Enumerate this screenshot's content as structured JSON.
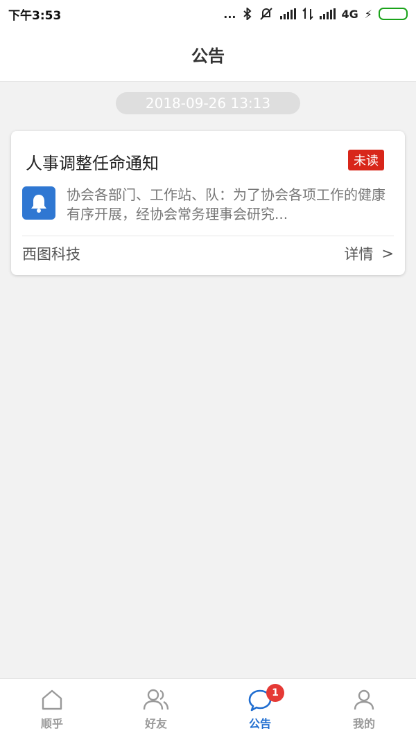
{
  "status_bar": {
    "time": "下午3:53",
    "dots": "...",
    "network": "4G",
    "charging": "⚡"
  },
  "header": {
    "title": "公告"
  },
  "feed": {
    "date": "2018-09-26 13:13",
    "card": {
      "title": "人事调整任命通知",
      "badge": "未读",
      "summary": "协会各部门、工作站、队：为了协会各项工作的健康有序开展，经协会常务理事会研究...",
      "source": "西图科技",
      "detail_label": "详情",
      "detail_arrow": ">"
    }
  },
  "bottom_nav": {
    "items": [
      {
        "label": "顺乎",
        "icon": "home-icon"
      },
      {
        "label": "好友",
        "icon": "friends-icon"
      },
      {
        "label": "公告",
        "icon": "chat-bubble-icon",
        "badge": "1",
        "active": true
      },
      {
        "label": "我的",
        "icon": "person-icon"
      }
    ]
  },
  "colors": {
    "accent": "#1f6dd0",
    "badge_red": "#d8261a",
    "bell_bg": "#2f77d2",
    "battery_green": "#1aa31a"
  }
}
